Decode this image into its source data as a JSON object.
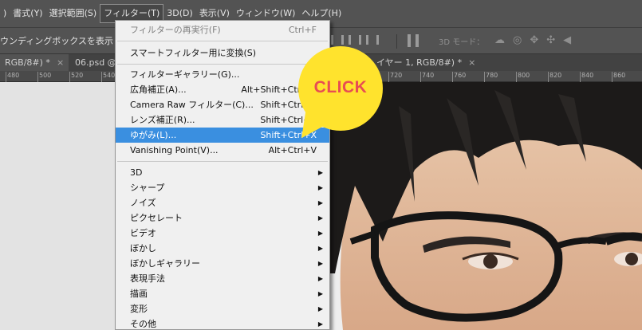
{
  "menubar": {
    "items": [
      {
        "label": ")"
      },
      {
        "label": "書式(Y)"
      },
      {
        "label": "選択範囲(S)"
      },
      {
        "label": "フィルター(T)",
        "active": true
      },
      {
        "label": "3D(D)"
      },
      {
        "label": "表示(V)"
      },
      {
        "label": "ウィンドウ(W)"
      },
      {
        "label": "ヘルプ(H)"
      }
    ]
  },
  "options_bar": {
    "label": "ウンディングボックスを表示",
    "mode_3d_label": "3D モード：",
    "icons_3d": [
      "orbit-icon",
      "roll-icon",
      "pan-icon",
      "slide-icon",
      "camera-icon"
    ]
  },
  "tabs": [
    {
      "label": "RGB/8#) *",
      "close": "×",
      "active": true
    },
    {
      "label": "06.psd @",
      "close": ""
    },
    {
      "label": "イヤー 1, RGB/8#) *",
      "close": "×"
    }
  ],
  "ruler": {
    "ticks": [
      "480",
      "500",
      "520",
      "540",
      "720",
      "740",
      "760",
      "780",
      "800",
      "820",
      "840",
      "860"
    ]
  },
  "filter_menu": {
    "items": [
      {
        "label": "フィルターの再実行(F)",
        "shortcut": "Ctrl+F",
        "disabled": true
      },
      {
        "label": "スマートフィルター用に変換(S)"
      },
      {
        "label": "フィルターギャラリー(G)..."
      },
      {
        "label": "広角補正(A)...",
        "shortcut": "Alt+Shift+Ctrl+A"
      },
      {
        "label": "Camera Raw フィルター(C)...",
        "shortcut": "Shift+Ctrl+A"
      },
      {
        "label": "レンズ補正(R)...",
        "shortcut": "Shift+Ctrl+R"
      },
      {
        "label": "ゆがみ(L)...",
        "shortcut": "Shift+Ctrl+X",
        "highlighted": true
      },
      {
        "label": "Vanishing Point(V)...",
        "shortcut": "Alt+Ctrl+V"
      },
      {
        "label": "3D",
        "submenu": "▶"
      },
      {
        "label": "シャープ",
        "submenu": "▶"
      },
      {
        "label": "ノイズ",
        "submenu": "▶"
      },
      {
        "label": "ピクセレート",
        "submenu": "▶"
      },
      {
        "label": "ビデオ",
        "submenu": "▶"
      },
      {
        "label": "ぼかし",
        "submenu": "▶"
      },
      {
        "label": "ぼかしギャラリー",
        "submenu": "▶"
      },
      {
        "label": "表現手法",
        "submenu": "▶"
      },
      {
        "label": "描画",
        "submenu": "▶"
      },
      {
        "label": "変形",
        "submenu": "▶"
      },
      {
        "label": "その他",
        "submenu": "▶"
      }
    ]
  },
  "callout": {
    "text": "CLICK"
  },
  "colors": {
    "highlight": "#3a8fe0",
    "callout_fill": "#ffe32d",
    "callout_text": "#e84d53",
    "menu_bg": "#f0f0f0",
    "chrome_bg": "#535353"
  }
}
